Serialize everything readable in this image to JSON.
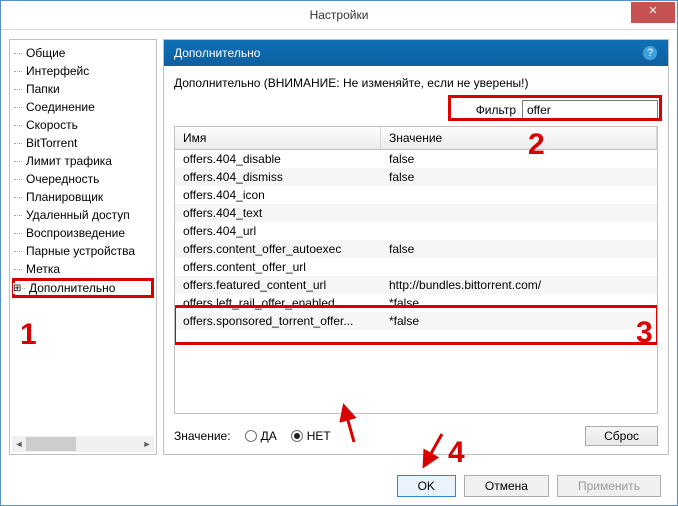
{
  "window": {
    "title": "Настройки",
    "close": "✕"
  },
  "sidebar": {
    "items": [
      "Общие",
      "Интерфейс",
      "Папки",
      "Соединение",
      "Скорость",
      "BitTorrent",
      "Лимит трафика",
      "Очередность",
      "Планировщик",
      "Удаленный доступ",
      "Воспроизведение",
      "Парные устройства",
      "Метка",
      "Дополнительно"
    ]
  },
  "main": {
    "header": "Дополнительно",
    "warning": "Дополнительно (ВНИМАНИЕ: Не изменяйте, если не уверены!)",
    "filter_label": "Фильтр",
    "filter_value": "offer",
    "columns": {
      "name": "Имя",
      "value": "Значение"
    },
    "rows": [
      {
        "name": "offers.404_disable",
        "value": "false"
      },
      {
        "name": "offers.404_dismiss",
        "value": "false"
      },
      {
        "name": "offers.404_icon",
        "value": ""
      },
      {
        "name": "offers.404_text",
        "value": ""
      },
      {
        "name": "offers.404_url",
        "value": ""
      },
      {
        "name": "offers.content_offer_autoexec",
        "value": "false"
      },
      {
        "name": "offers.content_offer_url",
        "value": ""
      },
      {
        "name": "offers.featured_content_url",
        "value": "http://bundles.bittorrent.com/"
      },
      {
        "name": "offers.left_rail_offer_enabled",
        "value": "*false"
      },
      {
        "name": "offers.sponsored_torrent_offer...",
        "value": "*false"
      }
    ],
    "value_label": "Значение:",
    "radio_yes": "ДА",
    "radio_no": "НЕТ",
    "reset": "Сброс"
  },
  "buttons": {
    "ok": "OK",
    "cancel": "Отмена",
    "apply": "Применить"
  },
  "annotations": {
    "n1": "1",
    "n2": "2",
    "n3": "3",
    "n4": "4"
  }
}
